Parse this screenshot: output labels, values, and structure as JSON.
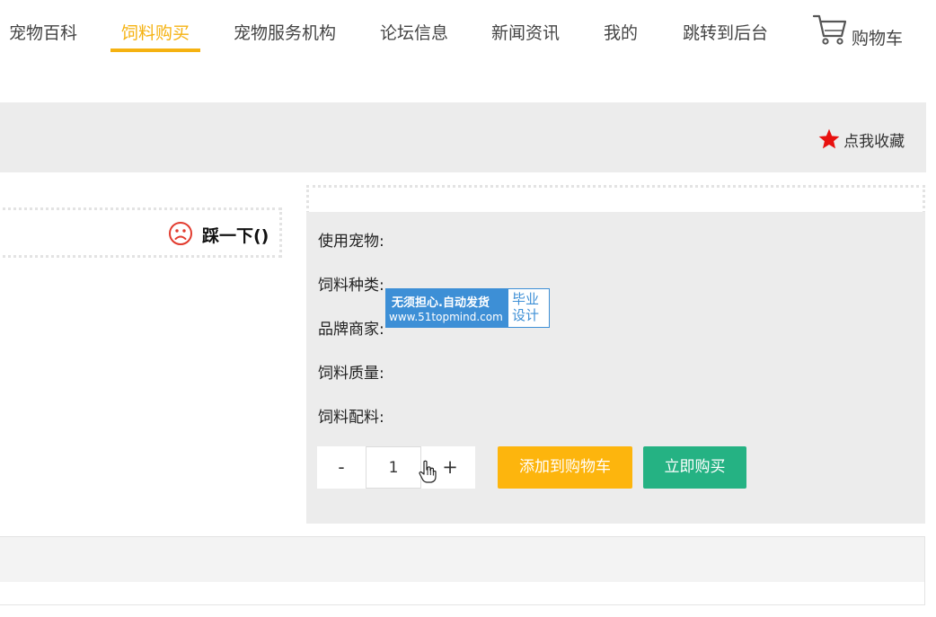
{
  "nav": {
    "items": [
      {
        "label": "宠物百科"
      },
      {
        "label": "饲料购买"
      },
      {
        "label": "宠物服务机构"
      },
      {
        "label": "论坛信息"
      },
      {
        "label": "新闻资讯"
      },
      {
        "label": "我的"
      },
      {
        "label": "跳转到后台"
      }
    ],
    "active_index": 1,
    "cart_label": "购物车",
    "cart_icon": "cart-icon"
  },
  "favorite": {
    "label": "点我收藏",
    "icon": "star-icon"
  },
  "dislike": {
    "label": "踩一下()",
    "icon": "sad-face-icon"
  },
  "product": {
    "fields": [
      {
        "label": "使用宠物:",
        "value": ""
      },
      {
        "label": "饲料种类:",
        "value": ""
      },
      {
        "label": "品牌商家:",
        "value": ""
      },
      {
        "label": "饲料质量:",
        "value": ""
      },
      {
        "label": "饲料配料:",
        "value": ""
      }
    ],
    "quantity": {
      "minus": "-",
      "value": "1",
      "plus": "+"
    },
    "add_to_cart": "添加到购物车",
    "buy_now": "立即购买"
  },
  "watermark": {
    "line1": "无须担心.自动发货",
    "line2": "www.51topmind.com",
    "right": "毕业设计"
  },
  "colors": {
    "accent": "#f5b211",
    "cart_button": "#fdb50d",
    "buy_button": "#25b283",
    "panel_bg": "#ececec",
    "star": "#e8110f",
    "watermark": "#3d8fd6"
  }
}
